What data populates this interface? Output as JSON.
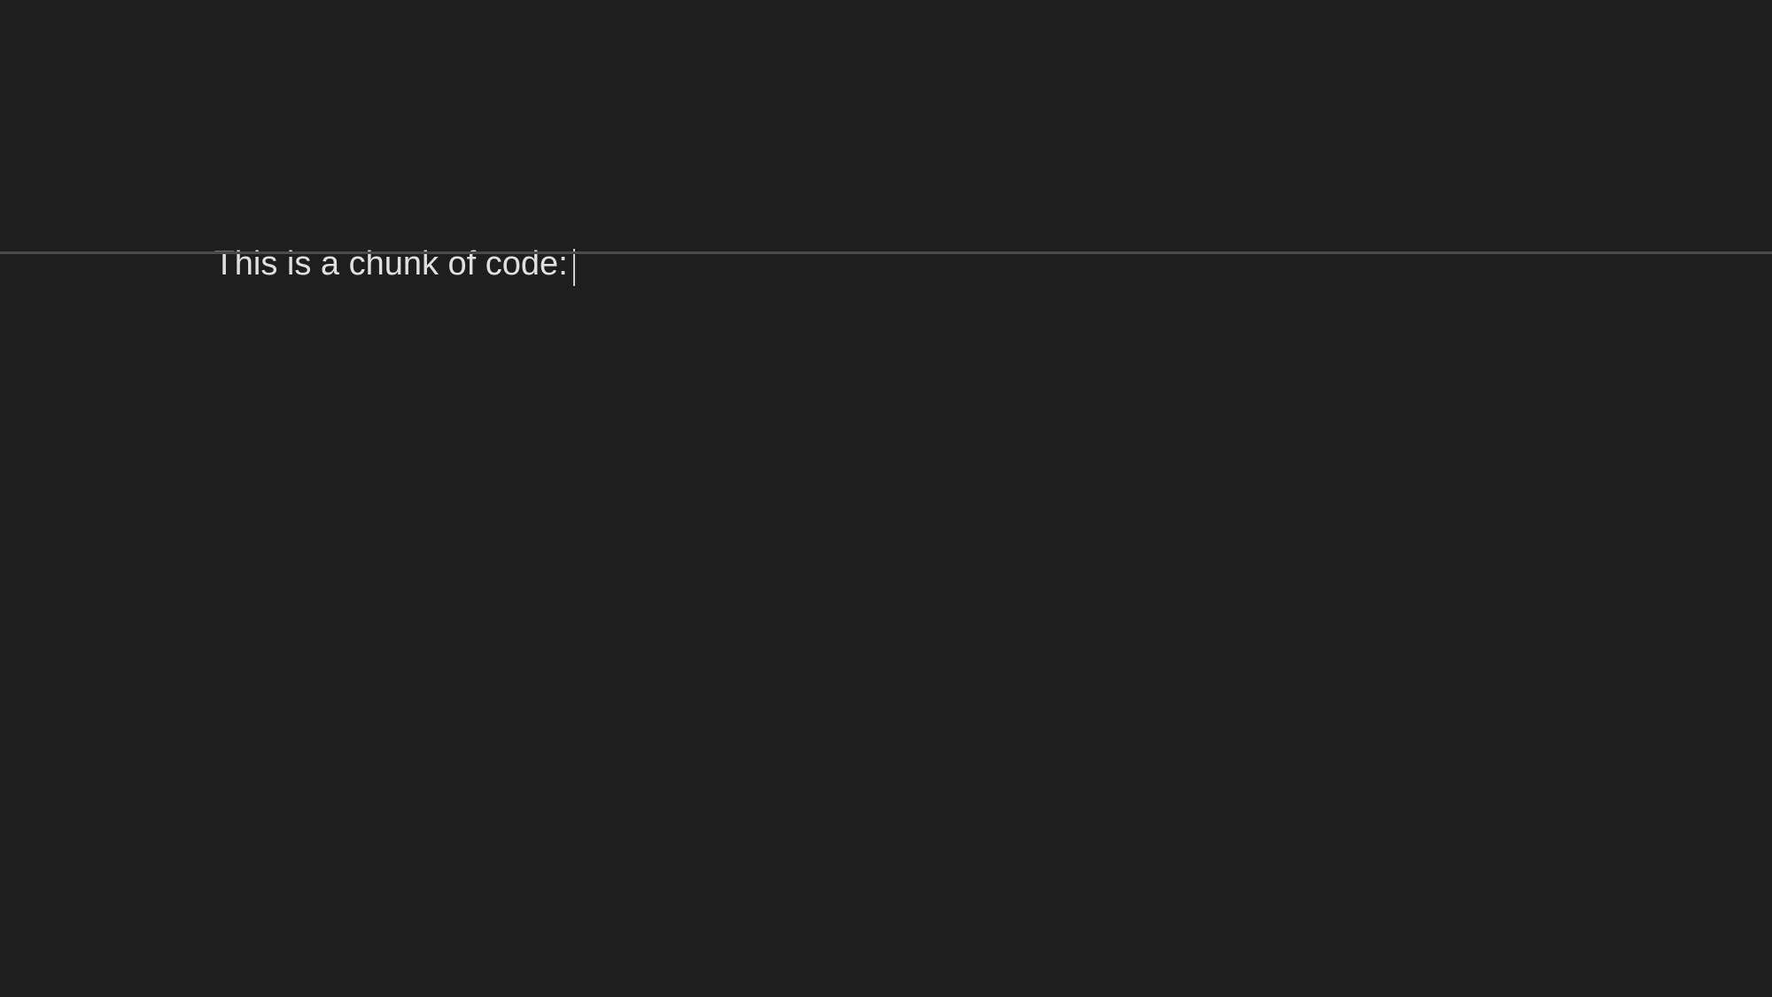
{
  "editor": {
    "text_content": "This is a chunk of code:",
    "background_color": "#1e1e1e",
    "text_color": "#e0e0e0",
    "divider_color": "#4a4a4a"
  }
}
